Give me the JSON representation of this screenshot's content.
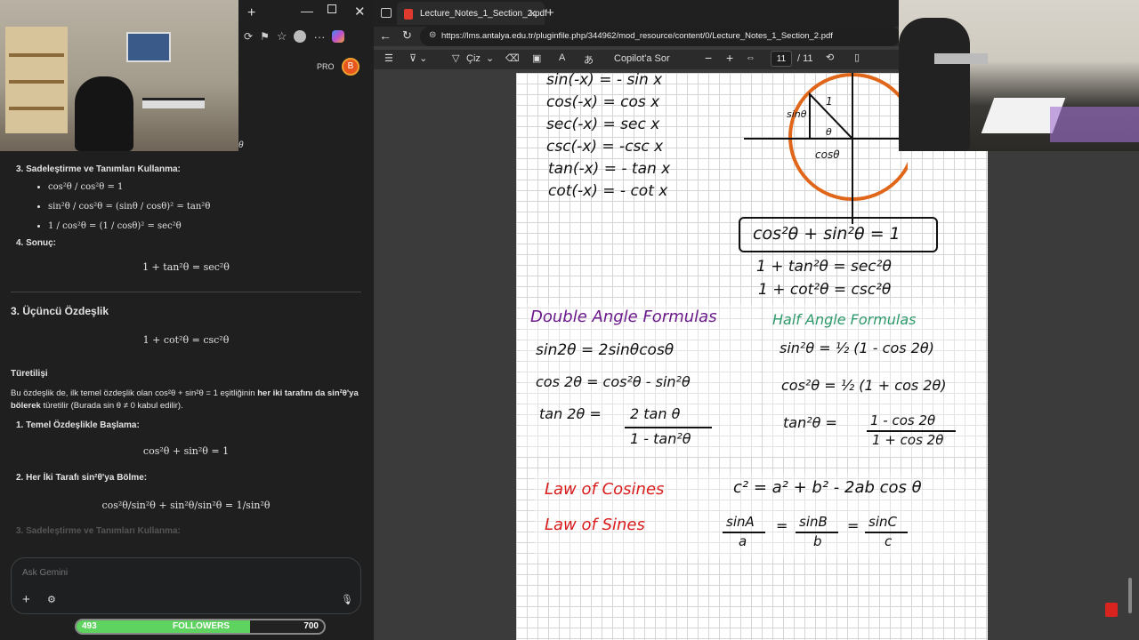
{
  "left": {
    "pro_badge": "PRO",
    "avatar_letter": "B",
    "step3_title": "3.  Sadeleştirme ve Tanımları Kullanma:",
    "bullet1": "cos²θ / cos²θ = 1",
    "bullet2": "sin²θ / cos²θ = (sinθ / cosθ)² = tan²θ",
    "bullet3": "1 / cos²θ = (1 / cosθ)² = sec²θ",
    "step4_title": "4.  Sonuç:",
    "result1": "1 + tan²θ = sec²θ",
    "section3_title": "3. Üçüncü Özdeşlik",
    "identity3": "1 + cot²θ = csc²θ",
    "derivation_title": "Türetilişi",
    "derivation_text_a": "Bu özdeşlik de, ilk temel özdeşlik olan cos²θ + sin²θ = 1 eşitliğinin",
    "derivation_bold": "her iki tarafını da sin²θ'ya bölerek",
    "derivation_text_b": "türetilir (Burada sin θ ≠ 0 kabul edilir).",
    "step1_title": "1.  Temel Özdeşlikle Başlama:",
    "eq_base": "cos²θ + sin²θ = 1",
    "step2_title": "2.  Her İki Tarafı sin²θ'ya Bölme:",
    "eq_div": "cos²θ/sin²θ + sin²θ/sin²θ = 1/sin²θ",
    "step3b_faded": "3.  Sadeleştirme ve Tanımları Kullanma:",
    "ask_placeholder": "Ask Gemini",
    "followers_label": "FOLLOWERS",
    "followers_current": "493",
    "followers_goal": "700",
    "followers_progress": 0.7
  },
  "browser": {
    "tab_title": "Lecture_Notes_1_Section_2.pdf",
    "url": "https://lms.antalya.edu.tr/pluginfile.php/344962/mod_resource/content/0/Lecture_Notes_1_Section_2.pdf",
    "draw_label": "Çiz",
    "copilot_label": "Copilot'a Sor",
    "page_current": "11",
    "page_total": "/ 11"
  },
  "notes": {
    "neg": [
      "sin(-x) = - sin x",
      "cos(-x) = cos x",
      "sec(-x) = sec x",
      "csc(-x) = -csc x",
      "tan(-x) = - tan x",
      "cot(-x) = - cot x"
    ],
    "circle_sin": "sinθ",
    "circle_cos": "cosθ",
    "circle_theta": "θ",
    "circle_one": "1",
    "pyth_main": "cos²θ + sin²θ = 1",
    "pyth2": "1 + tan²θ = sec²θ",
    "pyth3": "1 + cot²θ = csc²θ",
    "double_title": "Double Angle Formulas",
    "double_sin": "sin2θ = 2sinθcosθ",
    "double_cos": "cos 2θ = cos²θ - sin²θ",
    "double_tan_lhs": "tan 2θ =",
    "double_tan_num": "2 tan θ",
    "double_tan_den": "1 - tan²θ",
    "half_title": "Half Angle Formulas",
    "half_sin": "sin²θ = ½ (1 - cos 2θ)",
    "half_cos": "cos²θ = ½ (1 + cos 2θ)",
    "half_tan_lhs": "tan²θ =",
    "half_tan_num": "1 - cos 2θ",
    "half_tan_den": "1 + cos 2θ",
    "law_cos_label": "Law of Cosines",
    "law_cos_eq": "c² = a² + b² - 2ab cos θ",
    "law_sin_label": "Law of Sines",
    "law_sin_a": "sinA",
    "law_sin_a_den": "a",
    "law_sin_b": "sinB",
    "law_sin_b_den": "b",
    "law_sin_c": "sinC",
    "law_sin_c_den": "c",
    "eq": "="
  },
  "colors": {
    "purple": "#6b1a8a",
    "green": "#2e9a6a",
    "red": "#d91c1c",
    "orange": "#e0661a",
    "follow_green": "#5fd35f"
  }
}
